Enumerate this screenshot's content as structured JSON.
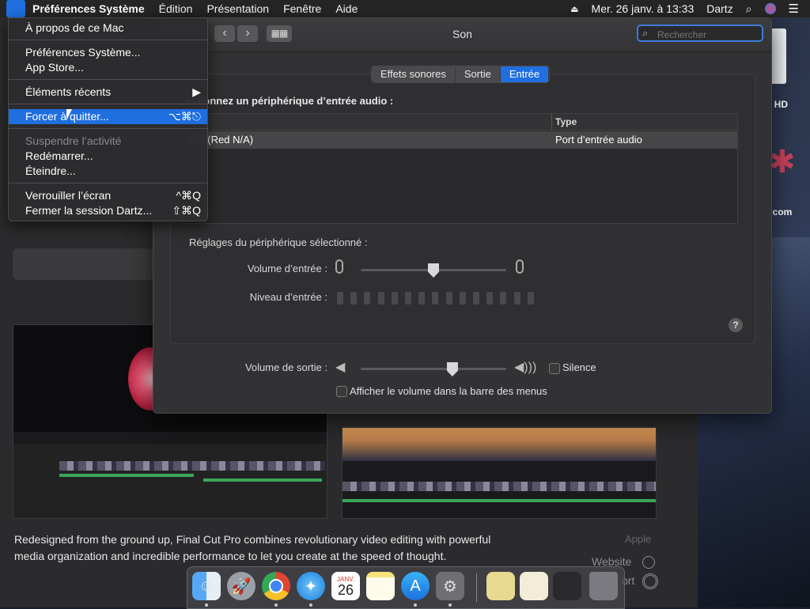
{
  "menubar": {
    "apple_icon": "apple-icon",
    "app_name": "Préférences Système",
    "items": [
      "Édition",
      "Présentation",
      "Fenêtre",
      "Aide"
    ],
    "clock": "Mer. 26 janv. à  13:33",
    "user": "Dartz"
  },
  "apple_menu": {
    "about": "À propos de ce Mac",
    "system_prefs": "Préférences Système...",
    "app_store": "App Store...",
    "recent": "Éléments récents",
    "force_quit": "Forcer à quitter...",
    "force_quit_shortcut": "⌥⌘⎋",
    "sleep": "Suspendre l’activité",
    "restart": "Redémarrer...",
    "shutdown": "Éteindre...",
    "lock": "Verrouiller l’écran",
    "lock_shortcut": "^⌘Q",
    "logout": "Fermer la session Dartz...",
    "logout_shortcut": "⇧⌘Q"
  },
  "sound_window": {
    "title": "Son",
    "search_placeholder": "Rechercher",
    "tabs": [
      "Effets sonores",
      "Sortie",
      "Entrée"
    ],
    "active_tab": "Entrée",
    "select_heading": "ectionnez un périphérique d’entrée audio :",
    "table": {
      "col_name": "n",
      "col_type": "Type",
      "rows": [
        {
          "name": "e-in (Red N/A)",
          "type": "Port d’entrée audio"
        }
      ]
    },
    "settings_heading": "Réglages du périphérique sélectionné :",
    "input_volume_label": "Volume d’entrée :",
    "input_volume_value": 0.5,
    "input_level_label": "Niveau d’entrée :",
    "input_level_value": 0,
    "output_volume_label": "Volume de sortie :",
    "output_volume_value": 0.63,
    "mute_label": "Silence",
    "mute_checked": false,
    "show_volume_label": "Afficher le volume dans la barre des menus",
    "show_volume_checked": false,
    "accent_color": "#1f6fe0"
  },
  "appstore": {
    "description": "Redesigned from the ground up, Final Cut Pro combines revolutionary video editing with powerful media organization and incredible performance to let you create at the speed of thought.",
    "developer_label": "Apple",
    "website_label": "Website",
    "support_label": "ort"
  },
  "desktop": {
    "hd_label": "n HD",
    "com_label": "n.com"
  },
  "dock": {
    "apps": [
      "finder-icon",
      "launchpad-icon",
      "chrome-icon",
      "safari-icon",
      "calendar-icon",
      "notes-icon",
      "app-store-icon",
      "system-preferences-icon"
    ],
    "calendar_month": "JANV.",
    "calendar_day": "26"
  }
}
